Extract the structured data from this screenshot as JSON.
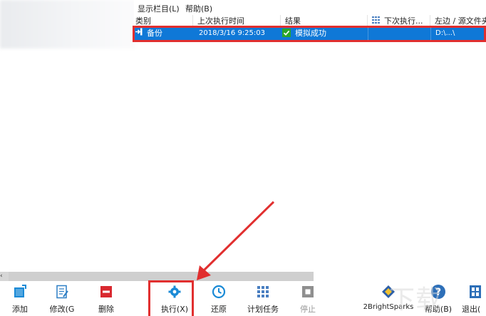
{
  "menu": {
    "columns": "显示栏目(L)",
    "help": "帮助(B)"
  },
  "table": {
    "headers": {
      "type": "类别",
      "last_run": "上次执行时间",
      "result": "结果",
      "next_run": "下次执行...",
      "left_source": "左边 / 源文件夹"
    },
    "rows": [
      {
        "type": "备份",
        "last_run": "2018/3/16 9:25:03",
        "result": "模拟成功",
        "next_run": "",
        "left_source": "D:\\...\\"
      }
    ]
  },
  "toolbar": {
    "add": "添加",
    "modify": "修改(G",
    "delete": "删除",
    "run": "执行(X)",
    "restore": "还原",
    "schedule": "计划任务",
    "stop": "停止",
    "brand": "2BrightSparks",
    "help": "帮助(B)",
    "exit": "退出("
  },
  "colors": {
    "selection": "#0f78d7",
    "annotation": "#e12f2f",
    "success": "#2aa52a",
    "toolbar_blue": "#1a8ad6",
    "delete_red": "#d9282f"
  },
  "icons": {
    "row": "arrow-into-icon",
    "result": "check-icon",
    "add": "add-icon",
    "modify": "modify-icon",
    "delete": "delete-icon",
    "run": "gear-icon",
    "restore": "clock-icon",
    "schedule": "grid-calendar-icon",
    "stop": "stop-icon",
    "brand": "diamond-icon",
    "help": "help-circle-icon",
    "exit": "exit-icon"
  }
}
